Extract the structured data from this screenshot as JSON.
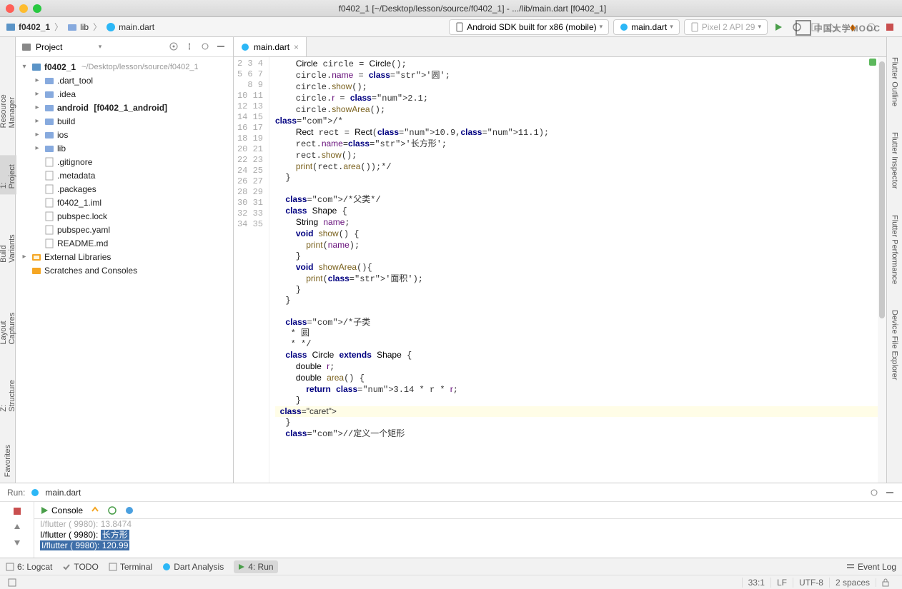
{
  "window": {
    "title": "f0402_1 [~/Desktop/lesson/source/f0402_1] - .../lib/main.dart [f0402_1]"
  },
  "breadcrumb": {
    "project": "f0402_1",
    "folder": "lib",
    "file": "main.dart"
  },
  "toolbar": {
    "device": "Android SDK built for x86 (mobile)",
    "config": "main.dart",
    "emulator": "Pixel 2 API 29"
  },
  "watermark_text": "中国大学MOOC",
  "project_panel": {
    "title": "Project",
    "root": {
      "name": "f0402_1",
      "path": "~/Desktop/lesson/source/f0402_1"
    },
    "items": [
      {
        "name": ".dart_tool",
        "type": "folder",
        "indent": 1
      },
      {
        "name": ".idea",
        "type": "folder",
        "indent": 1
      },
      {
        "name": "android",
        "suffix": "[f0402_1_android]",
        "type": "folder",
        "indent": 1,
        "bold": true
      },
      {
        "name": "build",
        "type": "folder",
        "indent": 1
      },
      {
        "name": "ios",
        "type": "folder",
        "indent": 1
      },
      {
        "name": "lib",
        "type": "folder",
        "indent": 1
      },
      {
        "name": ".gitignore",
        "type": "file",
        "indent": 1
      },
      {
        "name": ".metadata",
        "type": "file",
        "indent": 1
      },
      {
        "name": ".packages",
        "type": "file",
        "indent": 1
      },
      {
        "name": "f0402_1.iml",
        "type": "file",
        "indent": 1
      },
      {
        "name": "pubspec.lock",
        "type": "file",
        "indent": 1
      },
      {
        "name": "pubspec.yaml",
        "type": "file",
        "indent": 1
      },
      {
        "name": "README.md",
        "type": "file",
        "indent": 1
      }
    ],
    "external": "External Libraries",
    "scratches": "Scratches and Consoles"
  },
  "leftrail": {
    "l1": "Resource Manager",
    "l2": "1: Project",
    "l3": "Build Variants",
    "l4": "Layout Captures",
    "l5": "Z: Structure",
    "l6": "Favorites"
  },
  "rightrail": {
    "r1": "Flutter Outline",
    "r2": "Flutter Inspector",
    "r3": "Flutter Performance",
    "r4": "Device File Explorer"
  },
  "editor": {
    "tab": "main.dart",
    "first_line": 2,
    "lines": [
      "    Circle circle = Circle();",
      "    circle.name = '圆';",
      "    circle.show();",
      "    circle.r = 2.1;",
      "    circle.showArea();",
      "/*",
      "    Rect rect = Rect(10.9,11.1);",
      "    rect.name='长方形';",
      "    rect.show();",
      "    print(rect.area());*/",
      "  }",
      "",
      "  /*父类*/",
      "  class Shape {",
      "    String name;",
      "    void show() {",
      "      print(name);",
      "    }",
      "    void showArea(){",
      "      print('面积');",
      "    }",
      "  }",
      "",
      "  /*子类",
      "   * 圆",
      "   * */",
      "  class Circle extends Shape {",
      "    double r;",
      "    double area() {",
      "      return 3.14 * r * r;",
      "    }",
      "  |",
      "  }",
      "  //定义一个矩形"
    ]
  },
  "run": {
    "title": "Run:",
    "config": "main.dart",
    "console_tab": "Console",
    "lines": [
      {
        "prefix": "I/flutter ( 9980): ",
        "text": "13.8474",
        "hl": false,
        "prev": true
      },
      {
        "prefix": "I/flutter ( 9980): ",
        "text": "长方形",
        "hl": true
      },
      {
        "prefix": "I/flutter ( 9980): ",
        "text": "120.99",
        "hl": true,
        "full_hl": true
      }
    ]
  },
  "bottombar": {
    "logcat": "6: Logcat",
    "todo": "TODO",
    "terminal": "Terminal",
    "dart": "Dart Analysis",
    "run": "4: Run",
    "eventlog": "Event Log"
  },
  "status": {
    "pos": "33:1",
    "le": "LF",
    "enc": "UTF-8",
    "indent": "2 spaces"
  }
}
